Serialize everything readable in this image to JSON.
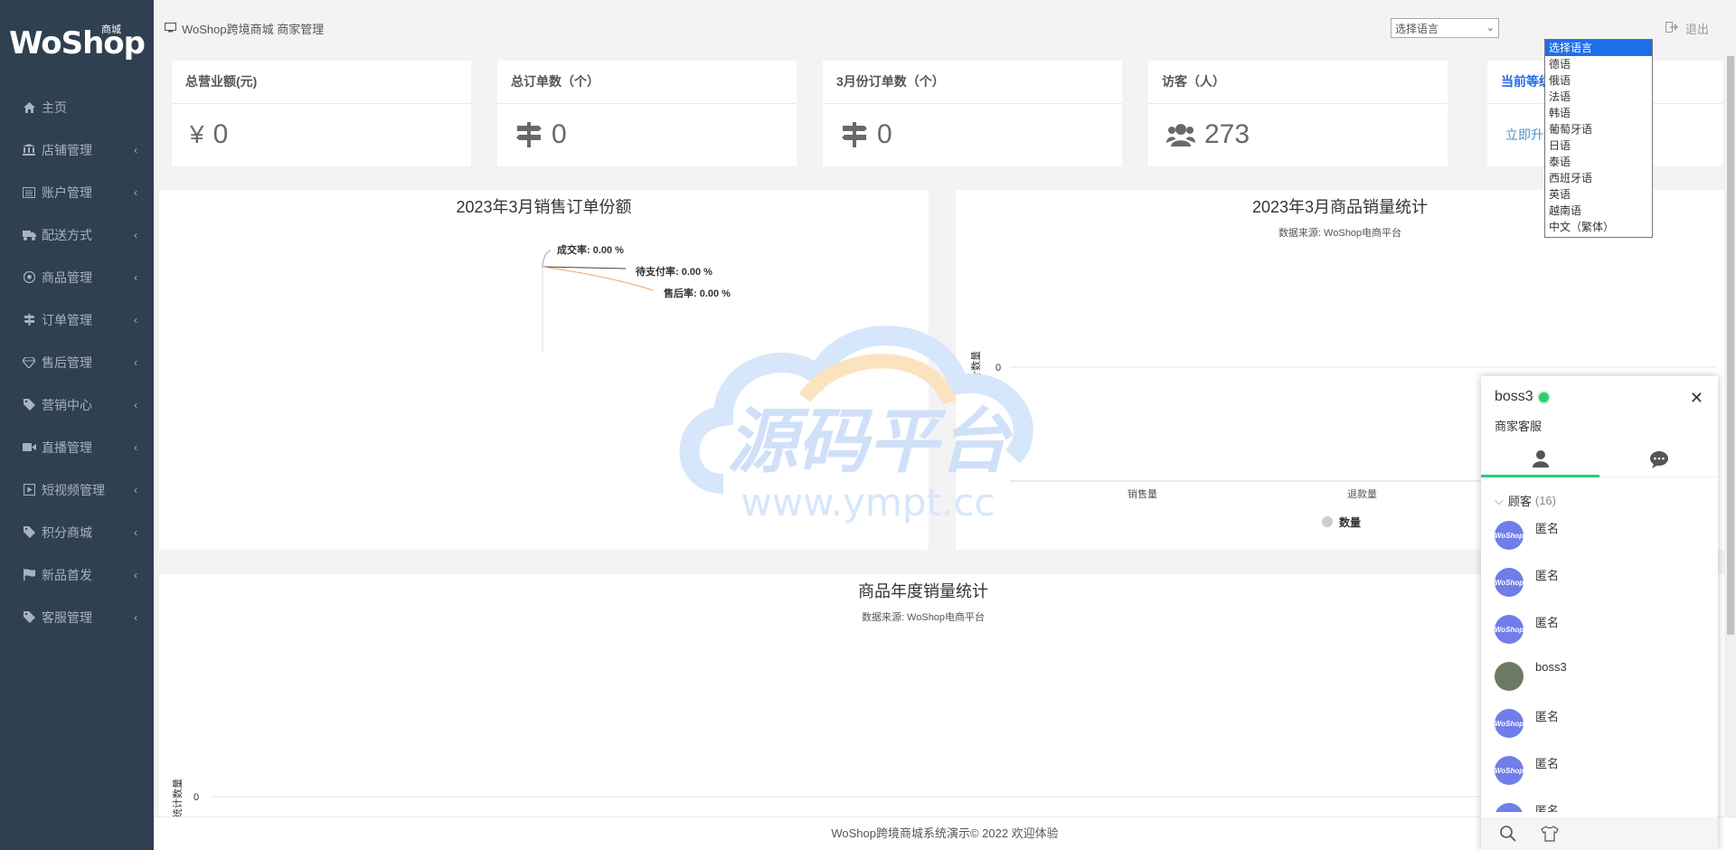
{
  "brand": {
    "name": "WoShop",
    "tag": "商城"
  },
  "breadcrumb": "WoShop跨境商城 商家管理",
  "sidebar": {
    "items": [
      {
        "label": "主页",
        "icon": "home-icon"
      },
      {
        "label": "店铺管理",
        "icon": "bank-icon"
      },
      {
        "label": "账户管理",
        "icon": "list-icon"
      },
      {
        "label": "配送方式",
        "icon": "truck-icon"
      },
      {
        "label": "商品管理",
        "icon": "soccer-icon"
      },
      {
        "label": "订单管理",
        "icon": "signpost-icon"
      },
      {
        "label": "售后管理",
        "icon": "diamond-icon"
      },
      {
        "label": "营销中心",
        "icon": "tag-icon"
      },
      {
        "label": "直播管理",
        "icon": "video-icon"
      },
      {
        "label": "短视频管理",
        "icon": "play-icon"
      },
      {
        "label": "积分商城",
        "icon": "tag-icon"
      },
      {
        "label": "新品首发",
        "icon": "flag-icon"
      },
      {
        "label": "客服管理",
        "icon": "tag-icon"
      }
    ]
  },
  "topbar": {
    "language_select": "选择语言",
    "logout": "退出"
  },
  "language_options": [
    "选择语言",
    "德语",
    "俄语",
    "法语",
    "韩语",
    "葡萄牙语",
    "日语",
    "泰语",
    "西班牙语",
    "英语",
    "越南语",
    "中文（繁体）"
  ],
  "cards": [
    {
      "title": "总营业额(元)",
      "value": "0",
      "prefix": "¥"
    },
    {
      "title": "总订单数（个）",
      "value": "0"
    },
    {
      "title": "3月份订单数（个）",
      "value": "0"
    },
    {
      "title": "访客（人）",
      "value": "273"
    },
    {
      "title": "当前等级",
      "link": "立即升级"
    }
  ],
  "chart_data": [
    {
      "type": "pie",
      "title": "2023年3月销售订单份额",
      "labels": [
        "成交率: 0.00 %",
        "待支付率: 0.00 %",
        "售后率: 0.00 %"
      ],
      "values": [
        0,
        0,
        0
      ]
    },
    {
      "type": "bar",
      "title": "2023年3月商品销量统计",
      "subtitle": "数据来源: WoShop电商平台",
      "ylabel": "统计数量",
      "categories": [
        "销售量",
        "退款量"
      ],
      "y_ticks": [
        "0"
      ],
      "series": [
        {
          "name": "数量",
          "values": [
            0,
            0
          ]
        }
      ]
    },
    {
      "type": "bar",
      "title": "商品年度销量统计",
      "subtitle": "数据来源: WoShop电商平台",
      "ylabel": "统计数量",
      "y_ticks": [
        "0"
      ]
    }
  ],
  "watermark": {
    "text": "源码平台",
    "url": "www.ympt.cc"
  },
  "chat": {
    "name": "boss3",
    "role": "商家客服",
    "group_label": "顾客",
    "group_count": "(16)",
    "avatar_text": "WoShop",
    "contacts": [
      {
        "name": "匿名",
        "avatar": "logo"
      },
      {
        "name": "匿名",
        "avatar": "logo"
      },
      {
        "name": "匿名",
        "avatar": "logo"
      },
      {
        "name": "boss3",
        "avatar": "photo"
      },
      {
        "name": "匿名",
        "avatar": "logo"
      },
      {
        "name": "匿名",
        "avatar": "logo"
      },
      {
        "name": "匿名",
        "avatar": "logo"
      }
    ]
  },
  "footer": "WoShop跨境商城系统演示© 2022 欢迎体验",
  "colors": {
    "sidebar_bg": "#2f4050",
    "accent_green": "#2ecc71",
    "select_blue": "#1e6ee8"
  }
}
